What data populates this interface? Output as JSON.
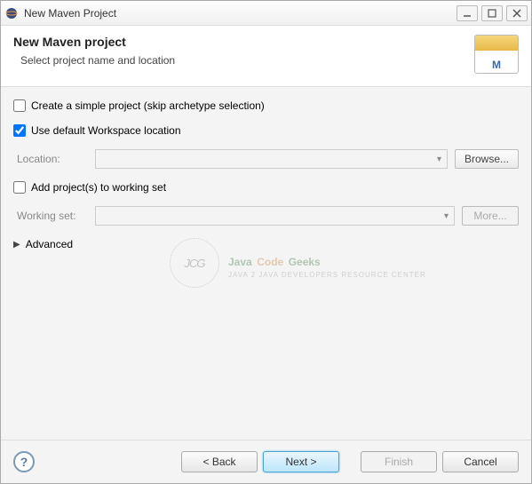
{
  "window": {
    "title": "New Maven Project"
  },
  "header": {
    "title": "New Maven project",
    "subtitle": "Select project name and location",
    "icon_letter": "M"
  },
  "form": {
    "simple_project_label": "Create a simple project (skip archetype selection)",
    "simple_project_checked": false,
    "use_default_label": "Use default Workspace location",
    "use_default_checked": true,
    "location_label": "Location:",
    "location_value": "",
    "browse_label": "Browse...",
    "add_working_set_label": "Add project(s) to working set",
    "add_working_set_checked": false,
    "working_set_label": "Working set:",
    "working_set_value": "",
    "more_label": "More...",
    "advanced_label": "Advanced"
  },
  "watermark": {
    "badge": "JCG",
    "main1": "Java",
    "main2": "Code",
    "main3": "Geeks",
    "tagline": "Java 2 Java Developers Resource Center"
  },
  "footer": {
    "back": "< Back",
    "next": "Next >",
    "finish": "Finish",
    "cancel": "Cancel"
  }
}
